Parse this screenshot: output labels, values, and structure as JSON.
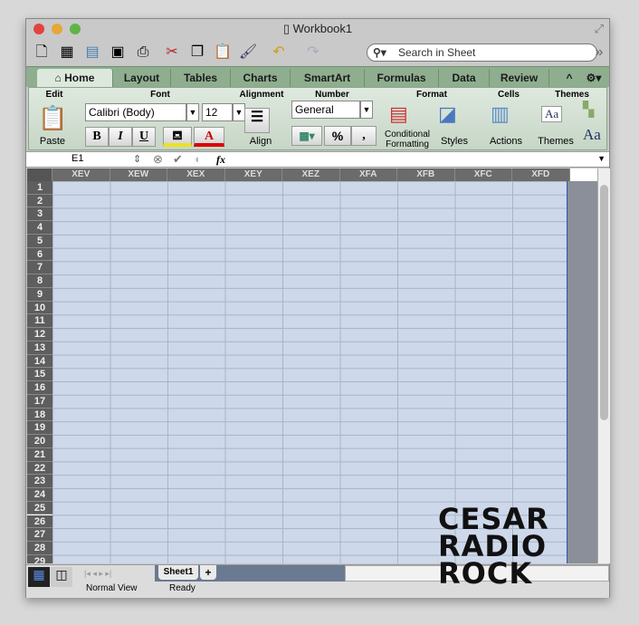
{
  "window": {
    "title": "Workbook1"
  },
  "toolbar": {
    "search_placeholder": "Search in Sheet",
    "icons": [
      "new-icon",
      "templates-icon",
      "open-icon",
      "save-icon",
      "print-icon",
      "cut-icon",
      "copy-icon",
      "paste-icon",
      "format-painter-icon",
      "undo-icon",
      "redo-icon"
    ]
  },
  "tabs": [
    "Home",
    "Layout",
    "Tables",
    "Charts",
    "SmartArt",
    "Formulas",
    "Data",
    "Review"
  ],
  "ribbon": {
    "groups": {
      "edit": "Edit",
      "font": "Font",
      "alignment": "Alignment",
      "number": "Number",
      "format": "Format",
      "cells": "Cells",
      "themes": "Themes"
    },
    "paste": "Paste",
    "font_name": "Calibri (Body)",
    "font_size": "12",
    "bold": "B",
    "italic": "I",
    "underline": "U",
    "font_color": "A",
    "align": "Align",
    "number_format": "General",
    "percent": "%",
    "comma": ",",
    "conditional_formatting": "Conditional Formatting",
    "styles": "Styles",
    "actions": "Actions",
    "themes": "Themes",
    "theme_fonts": "Aa",
    "theme_sample": "Aa"
  },
  "formula_bar": {
    "name_box": "E1",
    "fx": "fx",
    "value": ""
  },
  "columns": [
    "XEV",
    "XEW",
    "XEX",
    "XEY",
    "XEZ",
    "XFA",
    "XFB",
    "XFC",
    "XFD"
  ],
  "rows": [
    "1",
    "2",
    "3",
    "4",
    "5",
    "6",
    "7",
    "8",
    "9",
    "10",
    "11",
    "12",
    "13",
    "14",
    "15",
    "16",
    "17",
    "18",
    "19",
    "20",
    "21",
    "22",
    "23",
    "24",
    "25",
    "26",
    "27",
    "28",
    "29"
  ],
  "sheets": [
    "Sheet1"
  ],
  "add_sheet": "+",
  "status": {
    "view": "Normal View",
    "state": "Ready"
  },
  "selection_color": "#cdd8ea",
  "watermark": "CESAR RADIO ROCK"
}
